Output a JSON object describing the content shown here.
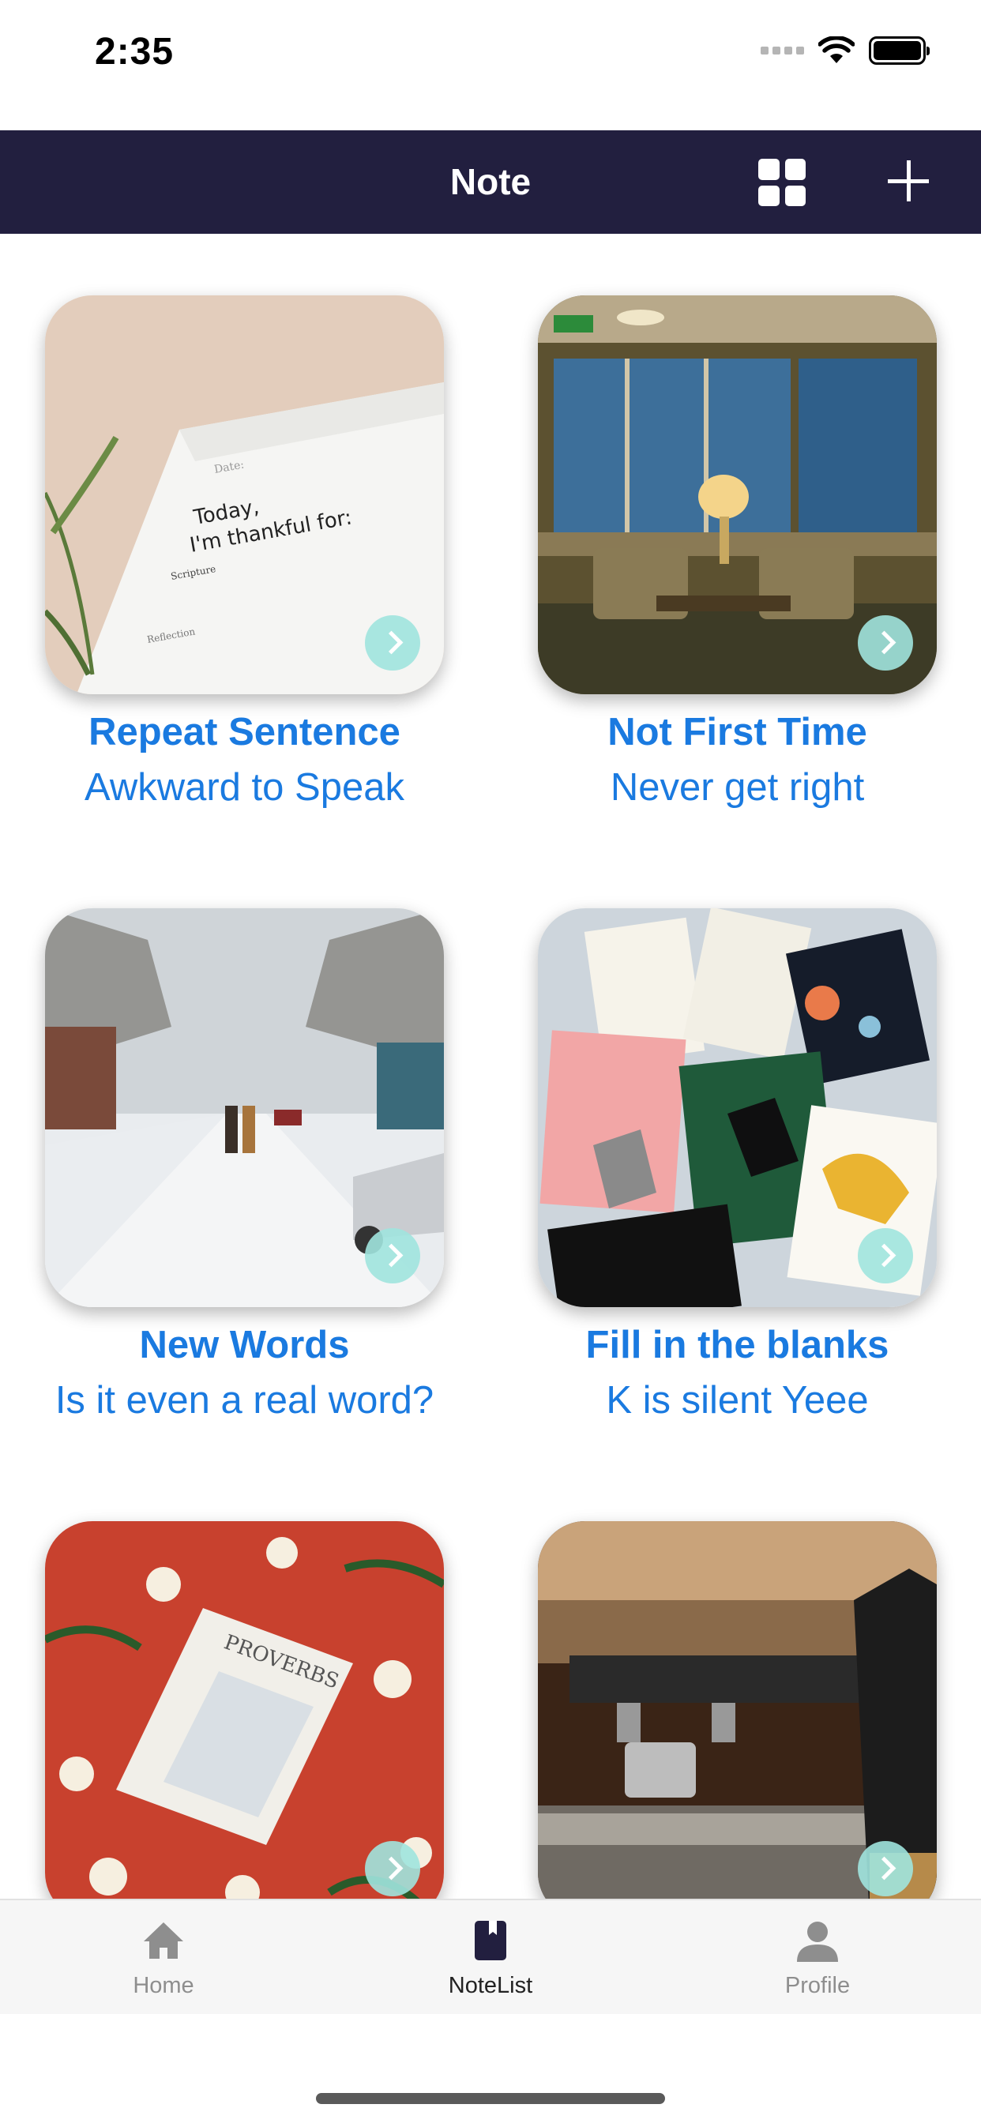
{
  "status_bar": {
    "time": "2:35"
  },
  "nav": {
    "title": "Note",
    "grid_icon": "grid-icon",
    "add_icon": "plus-icon"
  },
  "cards": [
    {
      "title": "Repeat Sentence",
      "subtitle": "Awkward to Speak",
      "image": "notebook-photo"
    },
    {
      "title": "Not First Time",
      "subtitle": "Never get right",
      "image": "lobby-photo"
    },
    {
      "title": "New Words",
      "subtitle": "Is it even a real word?",
      "image": "snowy-street-photo"
    },
    {
      "title": "Fill in the blanks",
      "subtitle": "K is silent Yeee",
      "image": "greeting-cards-photo"
    },
    {
      "title": "",
      "subtitle": "",
      "image": "proverbs-book-photo"
    },
    {
      "title": "",
      "subtitle": "",
      "image": "espresso-machine-photo"
    }
  ],
  "tabs": [
    {
      "label": "Home",
      "icon": "house-icon",
      "active": false
    },
    {
      "label": "NoteList",
      "icon": "book-icon",
      "active": true
    },
    {
      "label": "Profile",
      "icon": "person-icon",
      "active": false
    }
  ],
  "colors": {
    "nav_background": "#221f3f",
    "accent": "#1a7ae0",
    "arrow_badge": "#a0e4de"
  }
}
